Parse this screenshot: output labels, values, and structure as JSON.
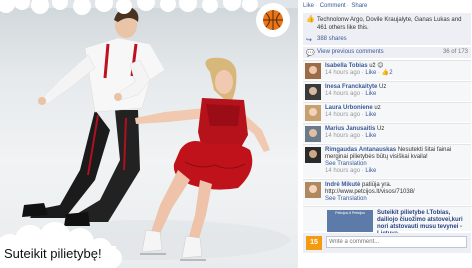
{
  "photo": {
    "caption": "Suteikit pilietybę!"
  },
  "fb": {
    "actions": [
      "Like",
      "Comment",
      "Share"
    ],
    "likes_text": "Technolonw Argo, Dovile Kraujalyte, Ganas Lukas and 461 others like this.",
    "shares_text": "388 shares",
    "view_previous": "View previous comments",
    "comment_count": "36 of 173",
    "comments": [
      {
        "name": "Isabella Tobias",
        "text": "už 😊",
        "time": "14 hours ago",
        "like": "Like",
        "likes": "2"
      },
      {
        "name": "Inesa Franckaityte",
        "text": "Uz",
        "time": "14 hours ago",
        "like": "Like",
        "likes": ""
      },
      {
        "name": "Laura Urboniene",
        "text": "uz",
        "time": "14 hours ago",
        "like": "Like",
        "likes": ""
      },
      {
        "name": "Marius Janusaitis",
        "text": "Uz",
        "time": "14 hours ago",
        "like": "Like",
        "likes": ""
      },
      {
        "name": "Rimgaudas Antanauskas",
        "text": "Nesutekti šitai fainai merginai pilietybės būtų visiškai kvaila!",
        "time": "14 hours ago",
        "like": "Like",
        "likes": "",
        "translation": "See Translation"
      },
      {
        "name": "Indrė Mikutė",
        "text": "patiūja yra. http://www.petcijos.lt/visos/71038/",
        "time": "",
        "like": "",
        "likes": "",
        "translation": "See Translation"
      }
    ],
    "ad_text": "Suteikit pilietybe I.Tobias, dailiojo čiuožimo atstovei,kuri nori atstovauti musu tevynei - Lietuva",
    "ad_thumb_text": "Peticijos.lt Peticijos",
    "composer_logo": "15",
    "composer_placeholder": "Write a comment..."
  },
  "colors": {
    "fb_blue": "#3b5998",
    "panel_bg": "#edeff4",
    "dress_red": "#c0121b"
  }
}
